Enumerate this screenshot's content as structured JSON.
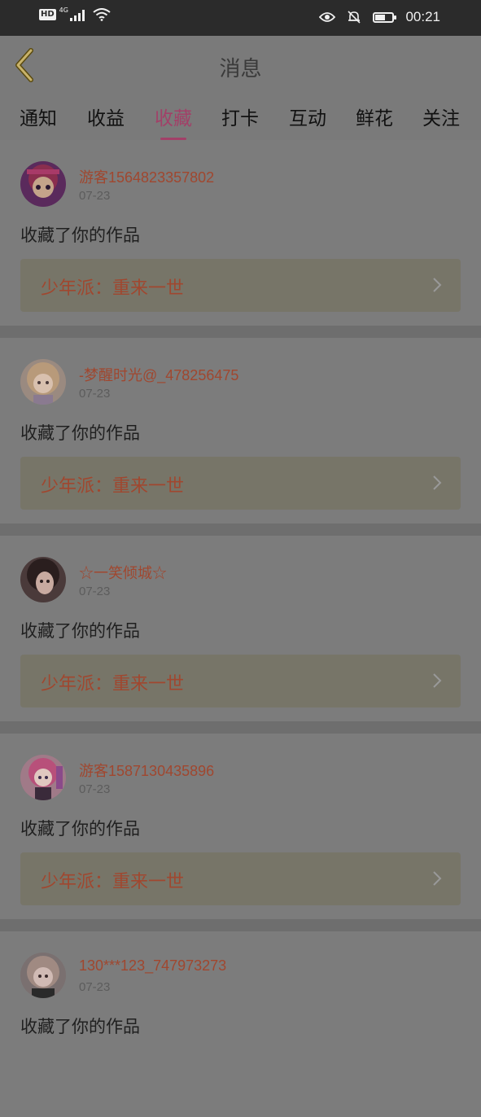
{
  "status_bar": {
    "hd_label": "HD",
    "network": "4G",
    "time": "00:21",
    "icons": [
      "signal-icon",
      "wifi-icon",
      "eye-icon",
      "bell-off-icon",
      "battery-icon"
    ],
    "battery_level": 0.5
  },
  "header": {
    "title": "消息",
    "back_icon": "chevron-left-icon"
  },
  "tabs": [
    {
      "label": "通知"
    },
    {
      "label": "收益"
    },
    {
      "label": "收藏"
    },
    {
      "label": "打卡"
    },
    {
      "label": "互动"
    },
    {
      "label": "鲜花"
    },
    {
      "label": "关注"
    }
  ],
  "active_tab": "收藏",
  "colors": {
    "accent": "#a24068",
    "username": "#a0472f",
    "status_bar_bg": "#2b2b2b"
  },
  "feed": {
    "items": [
      {
        "username": "游客1564823357802",
        "date": "07-23",
        "action": "收藏了你的作品",
        "work_title": "少年派：重来一世",
        "avatar_icon": "avatar-image"
      },
      {
        "username": "-梦醒时光@_478256475",
        "date": "07-23",
        "action": "收藏了你的作品",
        "work_title": "少年派：重来一世",
        "avatar_icon": "avatar-image"
      },
      {
        "username": "☆一笑倾城☆",
        "date": "07-23",
        "action": "收藏了你的作品",
        "work_title": "少年派：重来一世",
        "avatar_icon": "avatar-image"
      },
      {
        "username": "游客1587130435896",
        "date": "07-23",
        "action": "收藏了你的作品",
        "work_title": "少年派：重来一世",
        "avatar_icon": "avatar-image"
      },
      {
        "username": "130***123_747973273",
        "date": "07-23",
        "action": "收藏了你的作品",
        "work_title": "",
        "avatar_icon": "avatar-image"
      }
    ]
  }
}
